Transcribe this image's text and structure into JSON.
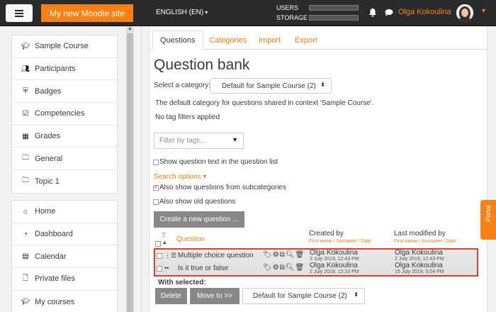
{
  "header": {
    "site_name": "My new Moodle site",
    "language": "ENGLISH (EN)",
    "usage": [
      {
        "label": "USERS",
        "fill_fraction": 0.0
      },
      {
        "label": "STORAGE",
        "fill_fraction": 0.0
      }
    ],
    "user_name": "Olga Kokoulina",
    "accent_color": "#f98012"
  },
  "sidebar": {
    "course_nav": [
      {
        "label": "Sample Course",
        "icon": "graduation-cap-icon"
      },
      {
        "label": "Participants",
        "icon": "users-icon"
      },
      {
        "label": "Badges",
        "icon": "badge-shield-icon"
      },
      {
        "label": "Competencies",
        "icon": "check-square-icon"
      },
      {
        "label": "Grades",
        "icon": "table-icon"
      },
      {
        "label": "General",
        "icon": "folder-icon"
      },
      {
        "label": "Topic 1",
        "icon": "folder-icon"
      }
    ],
    "site_nav": [
      {
        "label": "Home",
        "icon": "home-icon"
      },
      {
        "label": "Dashboard",
        "icon": "dashboard-icon"
      },
      {
        "label": "Calendar",
        "icon": "calendar-icon"
      },
      {
        "label": "Private files",
        "icon": "file-icon"
      },
      {
        "label": "My courses",
        "icon": "graduation-cap-icon"
      }
    ]
  },
  "tabs": [
    {
      "label": "Questions",
      "active": true
    },
    {
      "label": "Categories",
      "active": false
    },
    {
      "label": "Import",
      "active": false
    },
    {
      "label": "Export",
      "active": false
    }
  ],
  "page_title": "Question bank",
  "category": {
    "label": "Select a category:",
    "selected": "Default for Sample Course (2)"
  },
  "category_description": "The default category for questions shared in context 'Sample Course'.",
  "tag_filter_status": "No tag filters applied",
  "tag_filter_placeholder": "Filter by tags...",
  "options": {
    "show_question_text": "Show question text in the question list",
    "search_options": "Search options",
    "subcategories": "Also show questions from subcategories",
    "old_questions": "Also show old questions"
  },
  "create_button": "Create a new question ...",
  "table": {
    "type_header": "T",
    "question_header": "Question",
    "created_header": "Created by",
    "modified_header": "Last modified by",
    "sort_sub": "First name / Surname / Date",
    "rows": [
      {
        "name": "Multiple choice question",
        "created_by": "Olga Kokoulina",
        "created_date": "2 July 2019, 12:43 PM",
        "modified_by": "Olga Kokoulina",
        "modified_date": "2 July 2019, 12:43 PM"
      },
      {
        "name": "Is it true or false",
        "created_by": "Olga Kokoulina",
        "created_date": "2 July 2019, 12:10 PM",
        "modified_by": "Olga Kokoulina",
        "modified_date": "15 July 2019, 5:04 PM"
      }
    ]
  },
  "with_selected": "With selected:",
  "delete_button": "Delete",
  "move_button": "Move to >>",
  "move_target": "Default for Sample Course (2)",
  "portal_label": "Portal"
}
